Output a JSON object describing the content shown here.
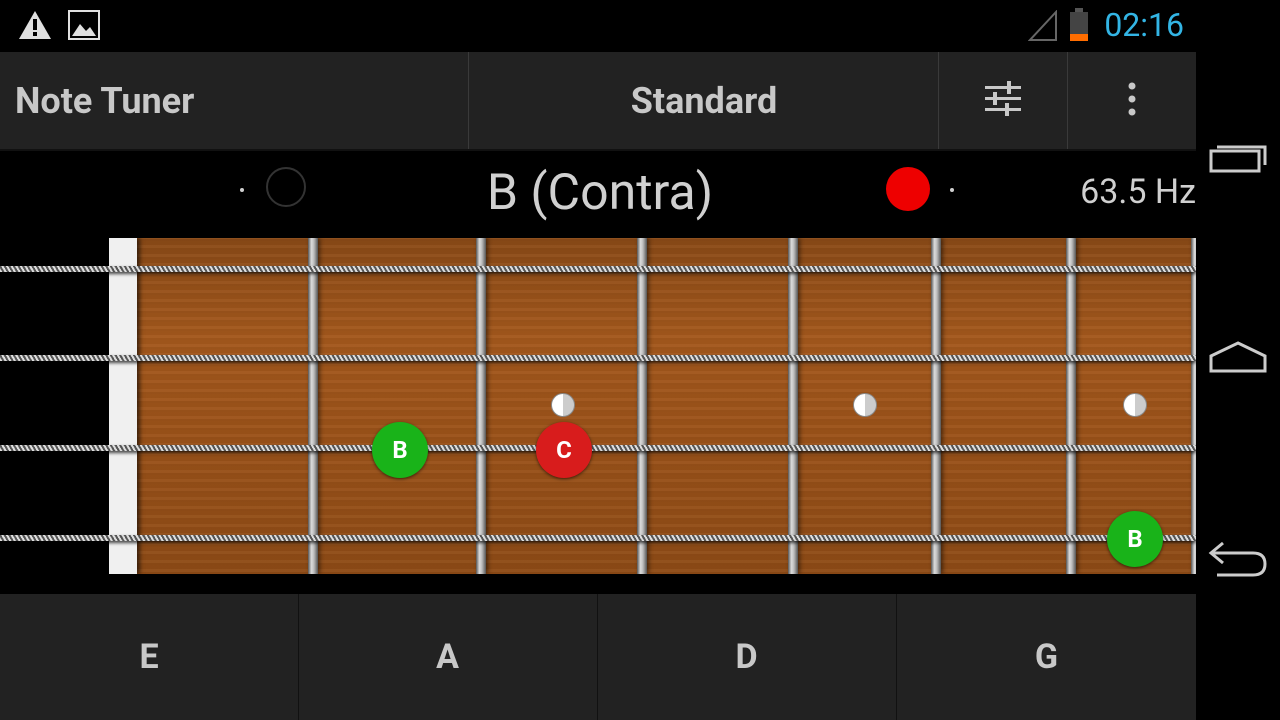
{
  "status_bar": {
    "icons": [
      "warning-icon",
      "image-icon",
      "signal-icon",
      "battery-icon"
    ],
    "time": "02:16",
    "time_color": "#33b5e5"
  },
  "action_bar": {
    "title": "Note Tuner",
    "tuning": "Standard",
    "buttons": [
      "settings-sliders-icon",
      "overflow-menu-icon"
    ]
  },
  "tuner": {
    "note": "B (Contra)",
    "frequency": "63.5 Hz",
    "indicator_left_active": false,
    "indicator_right_active": true,
    "active_color": "#ee0000"
  },
  "fretboard": {
    "markers": [
      {
        "label": "B",
        "color": "green"
      },
      {
        "label": "C",
        "color": "red"
      },
      {
        "label": "B",
        "color": "green"
      }
    ]
  },
  "strings": [
    {
      "label": "E"
    },
    {
      "label": "A"
    },
    {
      "label": "D"
    },
    {
      "label": "G"
    }
  ],
  "nav_bar": [
    "recent-apps-icon",
    "home-icon",
    "back-icon"
  ]
}
